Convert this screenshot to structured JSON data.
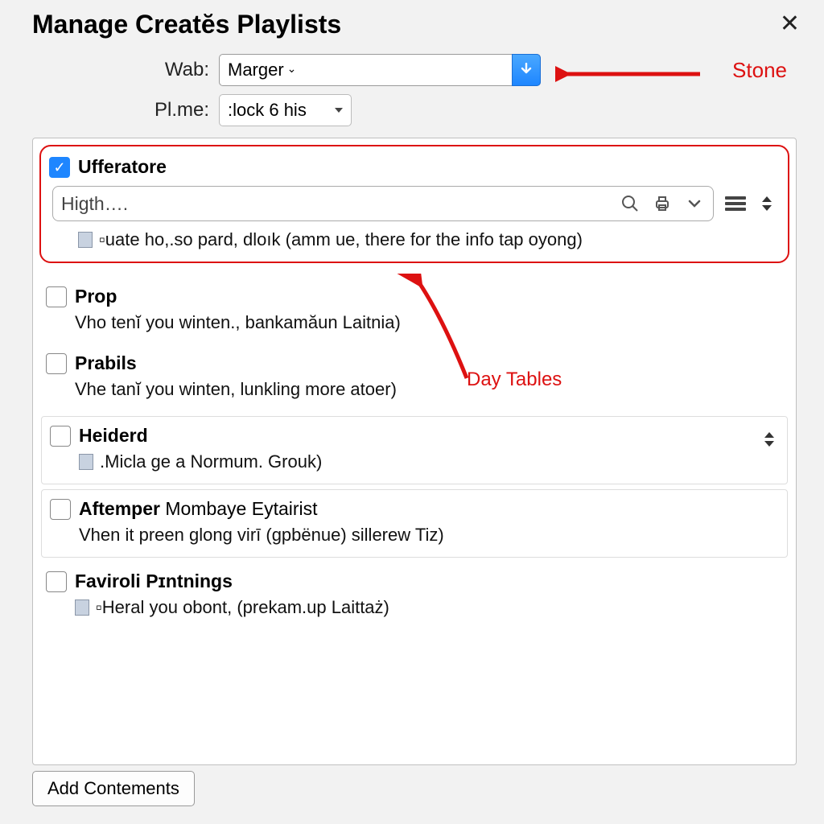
{
  "dialog": {
    "title": "Manage Creatĕs Playlists",
    "close_glyph": "✕"
  },
  "form": {
    "wab_label": "Wab:",
    "wab_value": "Marger",
    "plme_label": "Pl.me:",
    "plme_value": ":lock 6 his"
  },
  "search": {
    "placeholder": "Higth…."
  },
  "items": [
    {
      "checked": true,
      "title": "Ufferatore",
      "desc": "▫uate ho,.so pard, dloık (amm ue, there for the info tap oyong)"
    },
    {
      "checked": false,
      "title": "Prop",
      "desc": "Vho tenĭ you winten., bankamăun Laitnia)"
    },
    {
      "checked": false,
      "title": "Prabils",
      "desc": "Vhe tanĭ you winten, lunkling more atoer)"
    },
    {
      "checked": false,
      "title": "Heiderd",
      "desc": ".Micla ge a Normum. Grouk)"
    },
    {
      "checked": false,
      "title": "Aftemper",
      "title_suffix": " Mombaye Eytairist",
      "desc": "Vhen it preen glong virī (gpbënue) sillerew Tiz)"
    },
    {
      "checked": false,
      "title": "Faviroli Pɪntnings",
      "desc": "▫Heral you obont, (prekam.up Laittaż)"
    }
  ],
  "footer": {
    "add_label": "Add Contements"
  },
  "annotations": {
    "stone": "Stone",
    "day_tables": "Day Tables"
  }
}
